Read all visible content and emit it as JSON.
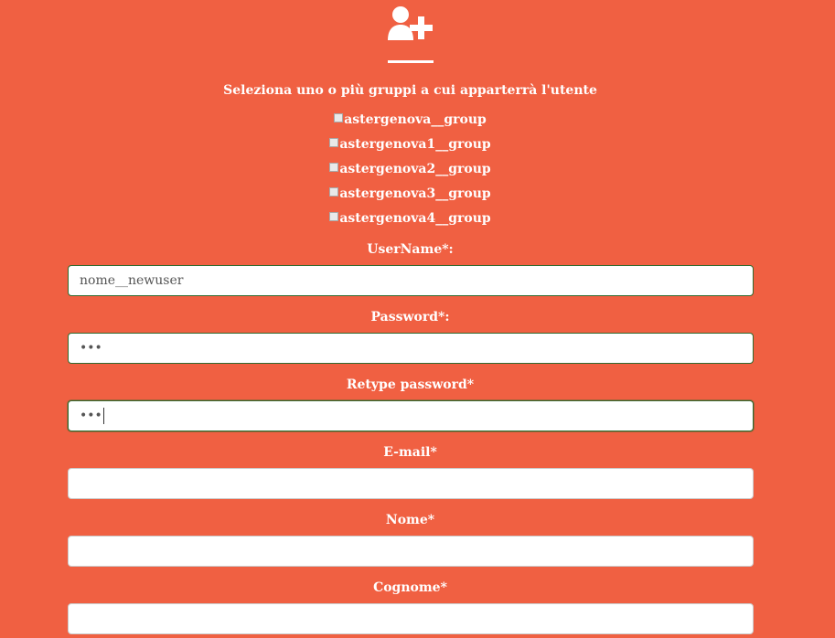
{
  "header": {
    "icon": "add-user-icon"
  },
  "groups": {
    "title": "Seleziona uno o più gruppi a cui apparterrà l'utente",
    "items": [
      {
        "label": "astergenova__group",
        "checked": false
      },
      {
        "label": "astergenova1__group",
        "checked": false
      },
      {
        "label": "astergenova2__group",
        "checked": false
      },
      {
        "label": "astergenova3__group",
        "checked": false
      },
      {
        "label": "astergenova4__group",
        "checked": false
      }
    ]
  },
  "form": {
    "username": {
      "label": "UserName*:",
      "value": "nome__newuser"
    },
    "password": {
      "label": "Password*:",
      "value": "•••"
    },
    "retype_password": {
      "label": "Retype password*",
      "value": "•••"
    },
    "email": {
      "label": "E-mail*",
      "value": ""
    },
    "nome": {
      "label": "Nome*",
      "value": ""
    },
    "cognome": {
      "label": "Cognome*",
      "value": ""
    }
  },
  "colors": {
    "background": "#f06042",
    "text": "#ffffff",
    "input_border_valid": "#2f6a2f"
  }
}
